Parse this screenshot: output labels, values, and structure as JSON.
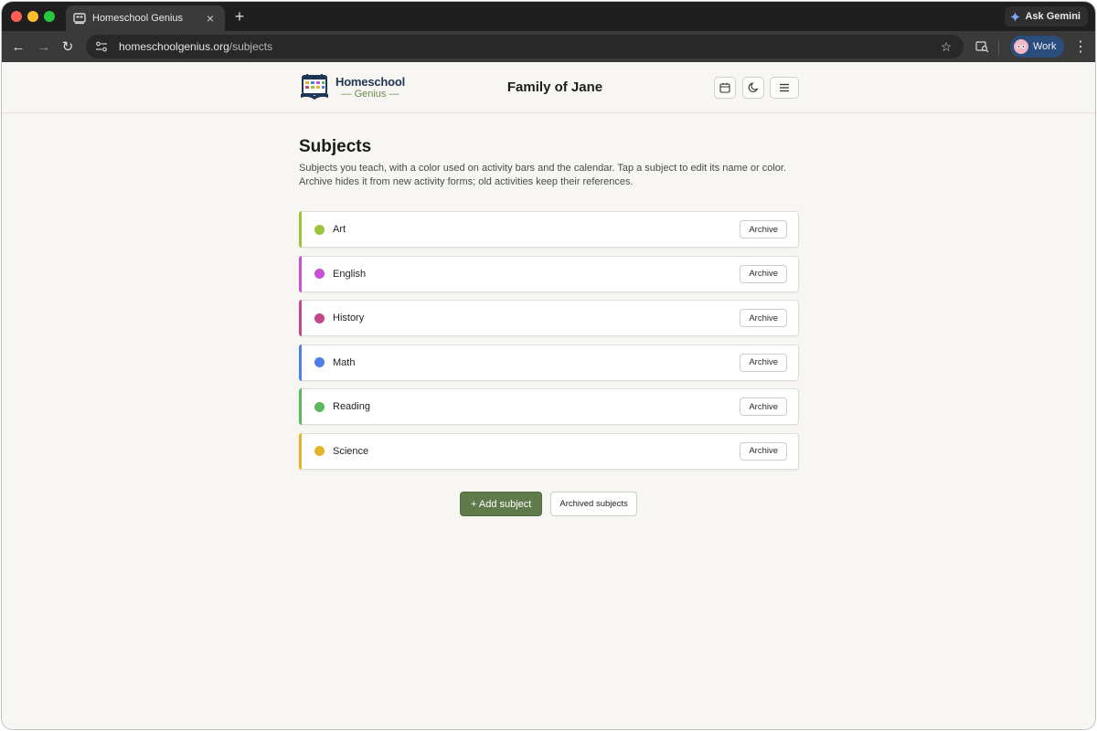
{
  "browser": {
    "tab_title": "Homeschool Genius",
    "tab_close": "×",
    "new_tab": "+",
    "ask_gemini": "Ask Gemini",
    "url_host": "homeschoolgenius.org",
    "url_path": "/subjects",
    "profile_label": "Work",
    "back_icon": "←",
    "forward_icon": "→",
    "reload_icon": "↻",
    "star_icon": "☆",
    "menu_icon": "⋮"
  },
  "header": {
    "logo_line1": "Homeschool",
    "logo_line2": "— Genius —",
    "family_title": "Family of Jane",
    "menu_icon": "≡"
  },
  "main": {
    "title": "Subjects",
    "description": "Subjects you teach, with a color used on activity bars and the calendar. Tap a subject to edit its name or color. Archive hides it from new activity forms; old activities keep their references.",
    "subjects": [
      {
        "name": "Art",
        "color": "#9cc43b",
        "archive_label": "Archive"
      },
      {
        "name": "English",
        "color": "#c94fd6",
        "archive_label": "Archive"
      },
      {
        "name": "History",
        "color": "#c4478a",
        "archive_label": "Archive"
      },
      {
        "name": "Math",
        "color": "#4f7ee6",
        "archive_label": "Archive"
      },
      {
        "name": "Reading",
        "color": "#5cb85c",
        "archive_label": "Archive"
      },
      {
        "name": "Science",
        "color": "#e3b32a",
        "archive_label": "Archive"
      }
    ],
    "add_subject_label": "+ Add subject",
    "archived_subjects_label": "Archived subjects"
  },
  "colors": {
    "accent_green": "#5f7a4b",
    "logo_navy": "#1f3554",
    "logo_green": "#6e8b4e"
  }
}
